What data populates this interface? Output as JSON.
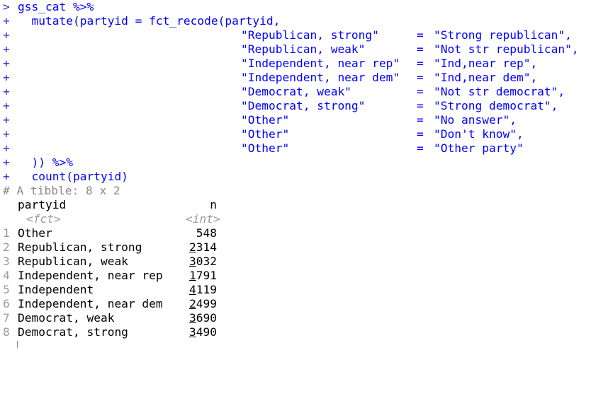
{
  "console": {
    "prompt_symbol": ">",
    "continuation_symbol": "+",
    "command": {
      "line1": "gss_cat %>%",
      "line2": "  mutate(partyid = fct_recode(partyid,",
      "recodes": [
        {
          "new": "\"Republican, strong\"",
          "eq": "=",
          "old": "\"Strong republican\","
        },
        {
          "new": "\"Republican, weak\"",
          "eq": "=",
          "old": "\"Not str republican\","
        },
        {
          "new": "\"Independent, near rep\"",
          "eq": "=",
          "old": "\"Ind,near rep\","
        },
        {
          "new": "\"Independent, near dem\"",
          "eq": "=",
          "old": "\"Ind,near dem\","
        },
        {
          "new": "\"Democrat, weak\"",
          "eq": "=",
          "old": "\"Not str democrat\","
        },
        {
          "new": "\"Democrat, strong\"",
          "eq": "=",
          "old": "\"Strong democrat\","
        },
        {
          "new": "\"Other\"",
          "eq": "=",
          "old": "\"No answer\","
        },
        {
          "new": "\"Other\"",
          "eq": "=",
          "old": "\"Don't know\","
        },
        {
          "new": "\"Other\"",
          "eq": "=",
          "old": "\"Other party\""
        }
      ],
      "line_close": "  )) %>%",
      "line_count": "  count(partyid)"
    },
    "output": {
      "header": "# A tibble: 8 x 2",
      "col1_name": "partyid",
      "col2_name": "n",
      "col1_type": "<fct>",
      "col2_type": "<int>",
      "rows": [
        {
          "idx": "1",
          "partyid": "Other",
          "n_first": "",
          "n_rest": "548"
        },
        {
          "idx": "2",
          "partyid": "Republican, strong",
          "n_first": "2",
          "n_rest": "314"
        },
        {
          "idx": "3",
          "partyid": "Republican, weak",
          "n_first": "3",
          "n_rest": "032"
        },
        {
          "idx": "4",
          "partyid": "Independent, near rep",
          "n_first": "1",
          "n_rest": "791"
        },
        {
          "idx": "5",
          "partyid": "Independent",
          "n_first": "4",
          "n_rest": "119"
        },
        {
          "idx": "6",
          "partyid": "Independent, near dem",
          "n_first": "2",
          "n_rest": "499"
        },
        {
          "idx": "7",
          "partyid": "Democrat, weak",
          "n_first": "3",
          "n_rest": "690"
        },
        {
          "idx": "8",
          "partyid": "Democrat, strong",
          "n_first": "3",
          "n_rest": "490"
        }
      ]
    }
  }
}
